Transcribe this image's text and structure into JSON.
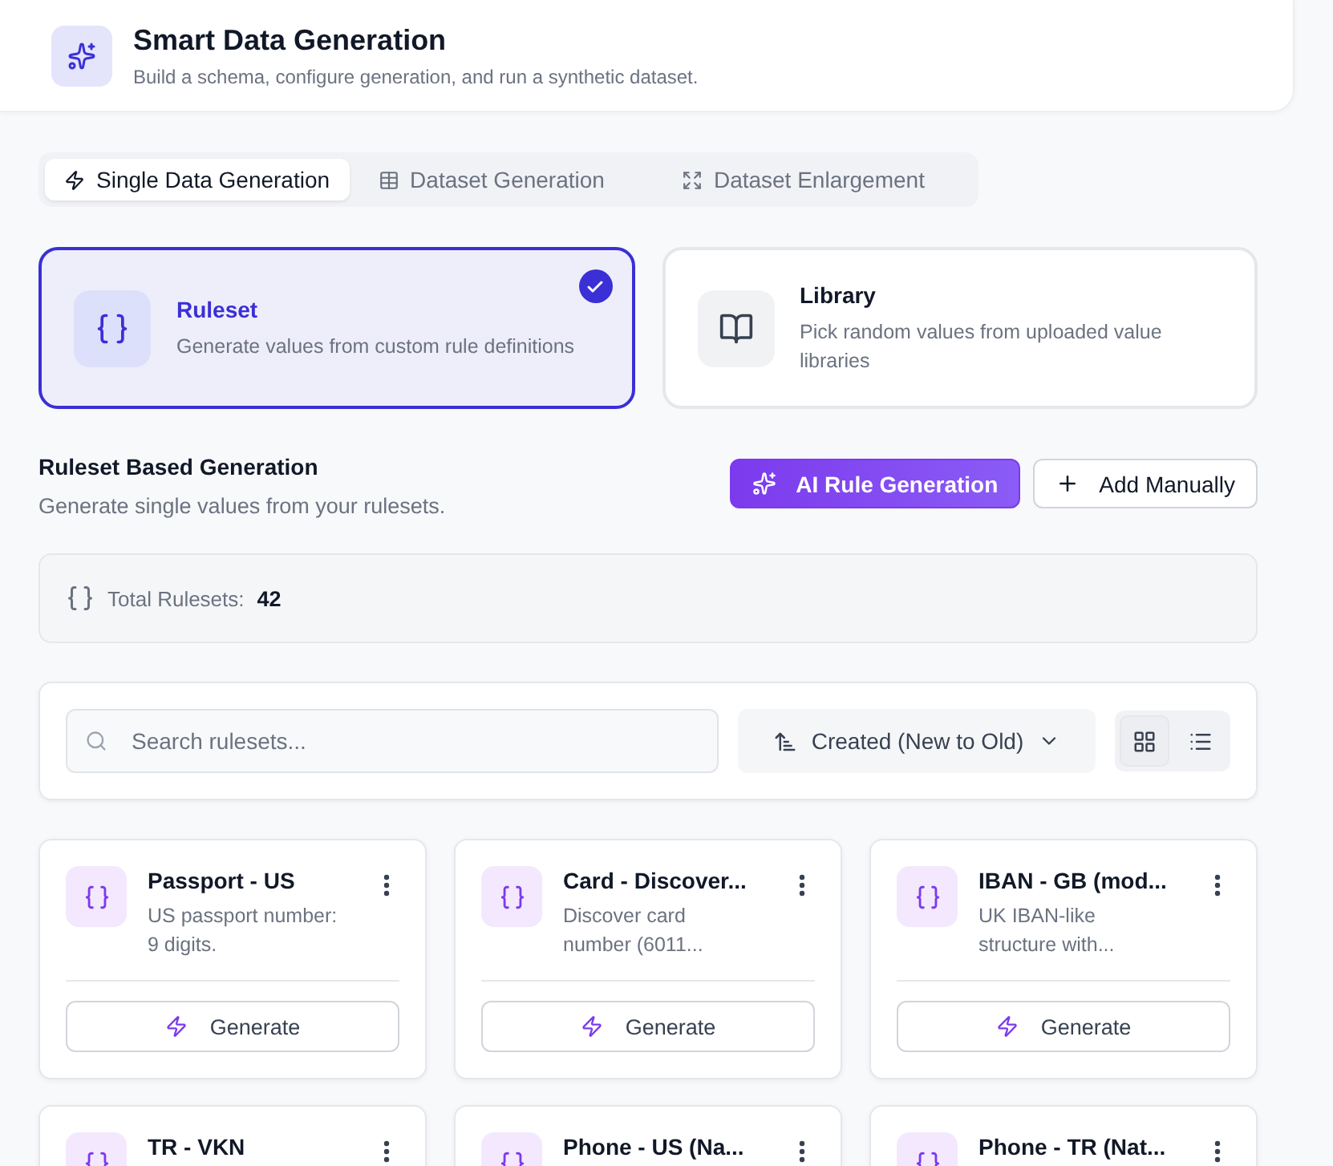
{
  "header": {
    "title": "Smart Data Generation",
    "subtitle": "Build a schema, configure generation, and run a synthetic dataset."
  },
  "tabs": [
    {
      "label": "Single Data Generation",
      "selected": true
    },
    {
      "label": "Dataset Generation",
      "selected": false
    },
    {
      "label": "Dataset Enlargement",
      "selected": false
    }
  ],
  "modes": [
    {
      "title": "Ruleset",
      "description": "Generate values from custom rule definitions",
      "selected": true
    },
    {
      "title": "Library",
      "description": "Pick random values from uploaded value libraries",
      "selected": false
    }
  ],
  "section": {
    "title": "Ruleset Based Generation",
    "subtitle": "Generate single values from your rulesets.",
    "buttons": [
      {
        "label": "AI Rule Generation",
        "kind": "primary"
      },
      {
        "label": "Add Manually",
        "kind": "secondary"
      }
    ]
  },
  "stats": {
    "label": "Total Rulesets:",
    "value": "42"
  },
  "toolbar": {
    "search_placeholder": "Search rulesets...",
    "sort": "Created (New to Old)",
    "views": [
      {
        "kind": "grid",
        "selected": true
      },
      {
        "kind": "list",
        "selected": false
      }
    ]
  },
  "rulesets": [
    {
      "title": "Passport - US",
      "description": "US passport number: 9 digits.",
      "button": "Generate"
    },
    {
      "title": "Card - Discover...",
      "description": "Discover card number (6011...",
      "button": "Generate"
    },
    {
      "title": "IBAN - GB (mod...",
      "description": "UK IBAN-like structure with...",
      "button": "Generate"
    },
    {
      "title": "TR - VKN"
    },
    {
      "title": "Phone - US (Na..."
    },
    {
      "title": "Phone - TR (Nat..."
    }
  ]
}
